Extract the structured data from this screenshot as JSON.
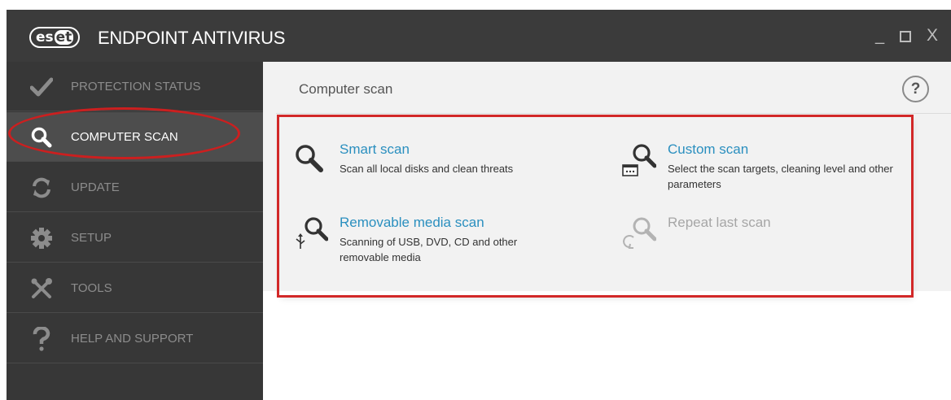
{
  "window": {
    "brand_logo": "eset",
    "title": "ENDPOINT ANTIVIRUS",
    "controls": {
      "minimize": "_",
      "close": "X"
    }
  },
  "sidebar": {
    "items": [
      {
        "label": "PROTECTION STATUS",
        "icon": "checkmark-icon",
        "active": false
      },
      {
        "label": "COMPUTER SCAN",
        "icon": "magnifier-icon",
        "active": true
      },
      {
        "label": "UPDATE",
        "icon": "refresh-icon",
        "active": false
      },
      {
        "label": "SETUP",
        "icon": "gear-icon",
        "active": false
      },
      {
        "label": "TOOLS",
        "icon": "tools-icon",
        "active": false
      },
      {
        "label": "HELP AND SUPPORT",
        "icon": "question-icon",
        "active": false
      }
    ]
  },
  "main": {
    "title": "Computer scan",
    "help_label": "?",
    "options": [
      {
        "title": "Smart scan",
        "description": "Scan all local disks and clean threats",
        "icon": "magnifier-icon",
        "enabled": true
      },
      {
        "title": "Custom scan",
        "description": "Select the scan targets, cleaning level and other parameters",
        "icon": "custom-scan-icon",
        "enabled": true
      },
      {
        "title": "Removable media scan",
        "description": "Scanning of USB, DVD, CD and other removable media",
        "icon": "usb-scan-icon",
        "enabled": true
      },
      {
        "title": "Repeat last scan",
        "description": "",
        "icon": "repeat-scan-icon",
        "enabled": false
      }
    ]
  },
  "colors": {
    "titlebar": "#3b3b3b",
    "sidebar": "#373737",
    "sidebar_active": "#4d4d4d",
    "link_blue": "#2a8fbf",
    "annotation_red": "#d22828"
  }
}
